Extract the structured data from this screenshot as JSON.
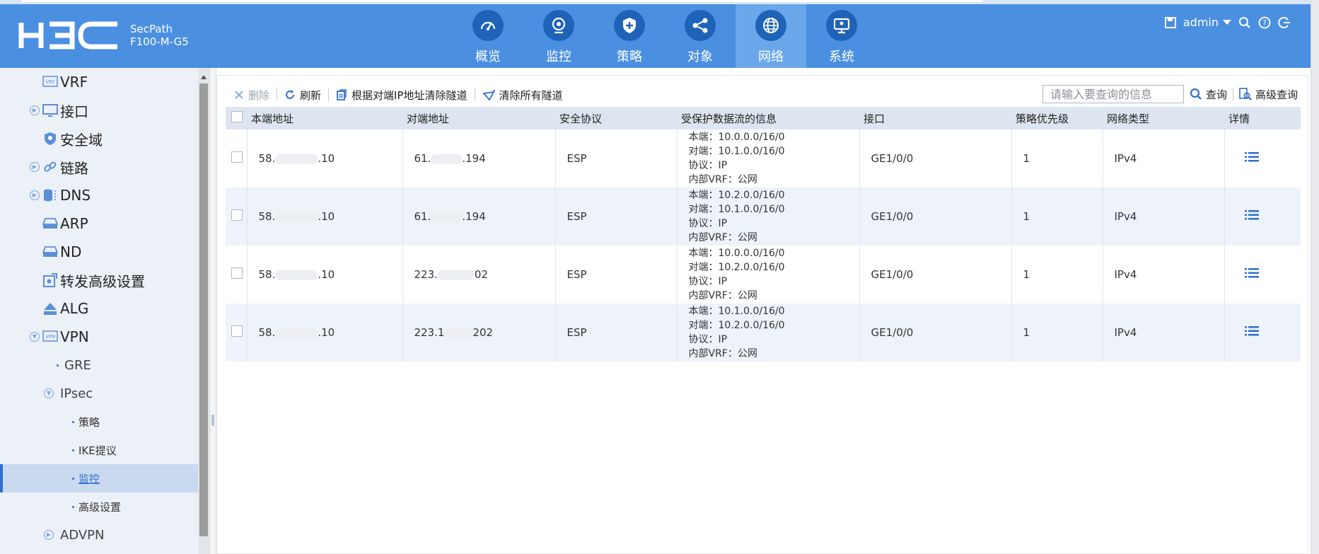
{
  "header": {
    "brand": "H3C",
    "product_line1": "SecPath",
    "product_line2": "F100-M-G5",
    "nav": [
      {
        "label": "概览",
        "icon": "dashboard-icon"
      },
      {
        "label": "监控",
        "icon": "monitor-camera-icon"
      },
      {
        "label": "策略",
        "icon": "shield-icon"
      },
      {
        "label": "对象",
        "icon": "share-nodes-icon"
      },
      {
        "label": "网络",
        "icon": "globe-icon",
        "active": true
      },
      {
        "label": "系统",
        "icon": "computer-icon"
      }
    ],
    "user": "admin"
  },
  "sidebar": {
    "items": [
      {
        "label": "VRF",
        "icon": "vrf-icon"
      },
      {
        "label": "接口",
        "icon": "interface-icon"
      },
      {
        "label": "安全域",
        "icon": "security-zone-icon"
      },
      {
        "label": "链路",
        "icon": "link-icon"
      },
      {
        "label": "DNS",
        "icon": "dns-icon"
      },
      {
        "label": "ARP",
        "icon": "arp-icon"
      },
      {
        "label": "ND",
        "icon": "nd-icon"
      },
      {
        "label": "转发高级设置",
        "icon": "forward-settings-icon"
      },
      {
        "label": "ALG",
        "icon": "alg-icon"
      },
      {
        "label": "VPN",
        "icon": "vpn-icon"
      },
      {
        "label": "GRE"
      },
      {
        "label": "IPsec"
      },
      {
        "label": "策略"
      },
      {
        "label": "IKE提议"
      },
      {
        "label": "监控",
        "active": true
      },
      {
        "label": "高级设置"
      },
      {
        "label": "ADVPN"
      }
    ]
  },
  "toolbar": {
    "delete": "删除",
    "refresh": "刷新",
    "clear_by_peer": "根据对端IP地址清除隧道",
    "clear_all": "清除所有隧道"
  },
  "search": {
    "placeholder": "请输入要查询的信息",
    "query": "查询",
    "advanced": "高级查询"
  },
  "table": {
    "columns": [
      "本端地址",
      "对端地址",
      "安全协议",
      "受保护数据流的信息",
      "接口",
      "策略优先级",
      "网络类型",
      "详情"
    ],
    "rows": [
      {
        "local_prefix": "58.",
        "local_suffix": ".10",
        "peer_prefix": "61.",
        "peer_suffix": ".194",
        "protocol": "ESP",
        "flow": [
          "本端：10.0.0.0/16/0",
          "对端：10.1.0.0/16/0",
          "协议：IP",
          "内部VRF：公网"
        ],
        "interface": "GE1/0/0",
        "priority": "1",
        "net_type": "IPv4"
      },
      {
        "local_prefix": "58.",
        "local_suffix": ".10",
        "peer_prefix": "61.",
        "peer_suffix": ".194",
        "protocol": "ESP",
        "flow": [
          "本端：10.2.0.0/16/0",
          "对端：10.1.0.0/16/0",
          "协议：IP",
          "内部VRF：公网"
        ],
        "interface": "GE1/0/0",
        "priority": "1",
        "net_type": "IPv4"
      },
      {
        "local_prefix": "58.",
        "local_suffix": ".10",
        "peer_prefix": "223.",
        "peer_suffix": "02",
        "protocol": "ESP",
        "flow": [
          "本端：10.0.0.0/16/0",
          "对端：10.2.0.0/16/0",
          "协议：IP",
          "内部VRF：公网"
        ],
        "interface": "GE1/0/0",
        "priority": "1",
        "net_type": "IPv4"
      },
      {
        "local_prefix": "58.",
        "local_suffix": ".10",
        "peer_prefix": "223.1",
        "peer_suffix": "202",
        "protocol": "ESP",
        "flow": [
          "本端：10.1.0.0/16/0",
          "对端：10.2.0.0/16/0",
          "协议：IP",
          "内部VRF：公网"
        ],
        "interface": "GE1/0/0",
        "priority": "1",
        "net_type": "IPv4"
      }
    ]
  },
  "colors": {
    "header_bg": "#4a8fe0",
    "nav_active": "#6aa6ea",
    "accent": "#2f6fcd",
    "sidebar_bg": "#ecf0f7"
  }
}
